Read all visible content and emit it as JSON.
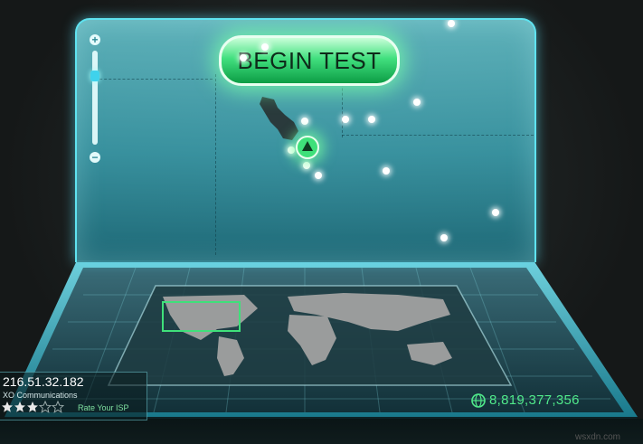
{
  "screen": {
    "begin_button_label": "BEGIN TEST",
    "zoom_in_label": "+",
    "zoom_out_label": "−"
  },
  "client": {
    "ip_address": "216.51.32.182",
    "isp_name": "XO Communications",
    "rating_stars": 3,
    "rating_max": 5,
    "rate_link_label": "Rate Your ISP"
  },
  "stats": {
    "total_tests": "8,819,377,356"
  },
  "watermark": "wsxdn.com",
  "colors": {
    "accent_green": "#3fe07a",
    "screen_cyan": "#5fe3f0",
    "counter_green": "#50e98a"
  },
  "icons": [
    "zoom-in-icon",
    "zoom-out-icon",
    "globe-icon",
    "star-icon",
    "triangle-marker-icon"
  ]
}
